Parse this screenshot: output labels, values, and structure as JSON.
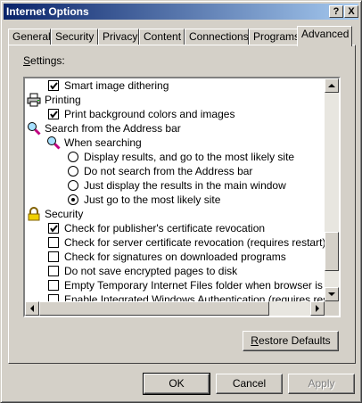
{
  "window": {
    "title": "Internet Options",
    "help_button": "?",
    "close_button": "X"
  },
  "tabs": [
    {
      "label": "General",
      "active": false
    },
    {
      "label": "Security",
      "active": false
    },
    {
      "label": "Privacy",
      "active": false
    },
    {
      "label": "Content",
      "active": false
    },
    {
      "label": "Connections",
      "active": false
    },
    {
      "label": "Programs",
      "active": false
    },
    {
      "label": "Advanced",
      "active": true
    }
  ],
  "settings_label": "Settings:",
  "settings": [
    {
      "type": "checkbox",
      "label": "Smart image dithering",
      "checked": true,
      "indent": 1
    },
    {
      "type": "category",
      "label": "Printing",
      "icon": "printer-icon",
      "indent": 0
    },
    {
      "type": "checkbox",
      "label": "Print background colors and images",
      "checked": true,
      "indent": 1
    },
    {
      "type": "category",
      "label": "Search from the Address bar",
      "icon": "magnifier-icon",
      "indent": 0
    },
    {
      "type": "subcategory",
      "label": "When searching",
      "icon": "magnifier-icon",
      "indent": 1
    },
    {
      "type": "radio",
      "label": "Display results, and go to the most likely site",
      "checked": false,
      "indent": 2
    },
    {
      "type": "radio",
      "label": "Do not search from the Address bar",
      "checked": false,
      "indent": 2
    },
    {
      "type": "radio",
      "label": "Just display the results in the main window",
      "checked": false,
      "indent": 2
    },
    {
      "type": "radio",
      "label": "Just go to the most likely site",
      "checked": true,
      "indent": 2
    },
    {
      "type": "category",
      "label": "Security",
      "icon": "lock-icon",
      "indent": 0
    },
    {
      "type": "checkbox",
      "label": "Check for publisher's certificate revocation",
      "checked": true,
      "indent": 1
    },
    {
      "type": "checkbox",
      "label": "Check for server certificate revocation (requires restart)",
      "checked": false,
      "indent": 1
    },
    {
      "type": "checkbox",
      "label": "Check for signatures on downloaded programs",
      "checked": false,
      "indent": 1
    },
    {
      "type": "checkbox",
      "label": "Do not save encrypted pages to disk",
      "checked": false,
      "indent": 1
    },
    {
      "type": "checkbox",
      "label": "Empty Temporary Internet Files folder when browser is closed",
      "checked": false,
      "indent": 1
    },
    {
      "type": "checkbox",
      "label": "Enable Integrated Windows Authentication (requires restart)",
      "checked": false,
      "indent": 1
    }
  ],
  "restore_button": "Restore Defaults",
  "ok_button": "OK",
  "cancel_button": "Cancel",
  "apply_button": "Apply",
  "colors": {
    "titlebar_start": "#0a246a",
    "titlebar_end": "#a6caf0",
    "face": "#d4d0c8"
  }
}
